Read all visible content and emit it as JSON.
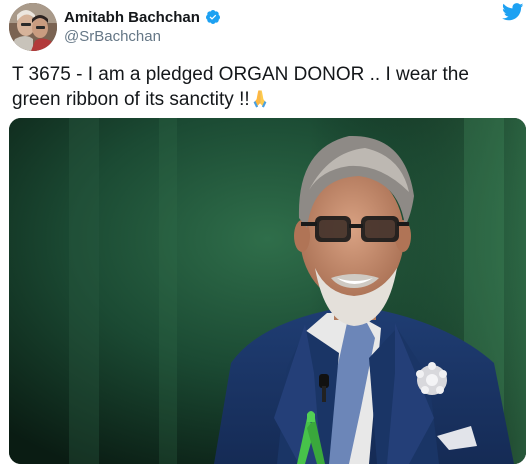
{
  "author": {
    "display_name": "Amitabh Bachchan",
    "handle": "@SrBachchan",
    "verified": true
  },
  "icons": {
    "verified": "verified-badge-icon",
    "twitter": "twitter-bird-icon",
    "emoji": "folded-hands-emoji"
  },
  "colors": {
    "twitter_blue": "#1da1f2",
    "text": "#14171a",
    "secondary_text": "#657786"
  },
  "tweet": {
    "text": "T 3675 - I am a pledged ORGAN DONOR  .. I wear the green ribbon of its sanctity  !!"
  }
}
